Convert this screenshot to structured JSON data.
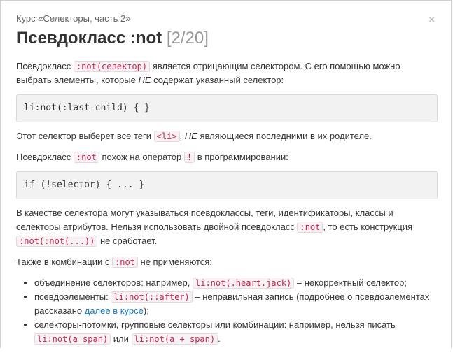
{
  "close_label": "×",
  "course": {
    "prefix": "Курс «",
    "link": "Селекторы, часть 2",
    "suffix": "»"
  },
  "title": {
    "main": "Псевдокласс :not",
    "counter": "[2/20]"
  },
  "p1": {
    "t1": "Псевдокласс ",
    "c1": ":not(селектор)",
    "t2": " является отрицающим селектором. С его помощью можно выбрать элементы, которые ",
    "em": "НЕ",
    "t3": " содержат указанный селектор:"
  },
  "code1": "li:not(:last-child) { }",
  "p2": {
    "t1": "Этот селектор выберет все теги ",
    "c1": "<li>",
    "t2": ", ",
    "em": "НЕ",
    "t3": " являющиеся последними в их родителе."
  },
  "p3": {
    "t1": "Псевдокласс ",
    "c1": ":not",
    "t2": " похож на оператор ",
    "c2": "!",
    "t3": " в программировании:"
  },
  "code2": "if (!selector) { ... }",
  "p4": {
    "t1": "В качестве селектора могут указываться псевдоклассы, теги, идентификаторы, классы и селекторы атрибутов. Нельзя использовать двойной псевдокласс ",
    "c1": ":not",
    "t2": ", то есть конструкция ",
    "c2": ":not(:not(...))",
    "t3": " не сработает."
  },
  "p5": {
    "t1": "Также в комбинации с ",
    "c1": ":not",
    "t2": " не применяются:"
  },
  "list": {
    "i1": {
      "t1": "объединение селекторов: например, ",
      "c1": "li:not(.heart.jack)",
      "t2": " – некорректный селектор;"
    },
    "i2": {
      "t1": "псевдоэлементы: ",
      "c1": "li:not(::after)",
      "t2": " – неправильная запись (подробнее о псевдоэлементах рассказано ",
      "link": "далее в курсе",
      "t3": ");"
    },
    "i3": {
      "t1": "селекторы-потомки, групповые селекторы или комбинации: например, нельзя писать ",
      "c1": "li:not(a span)",
      "t2": " или ",
      "c2": "li:not(a + span)",
      "t3": "."
    }
  }
}
